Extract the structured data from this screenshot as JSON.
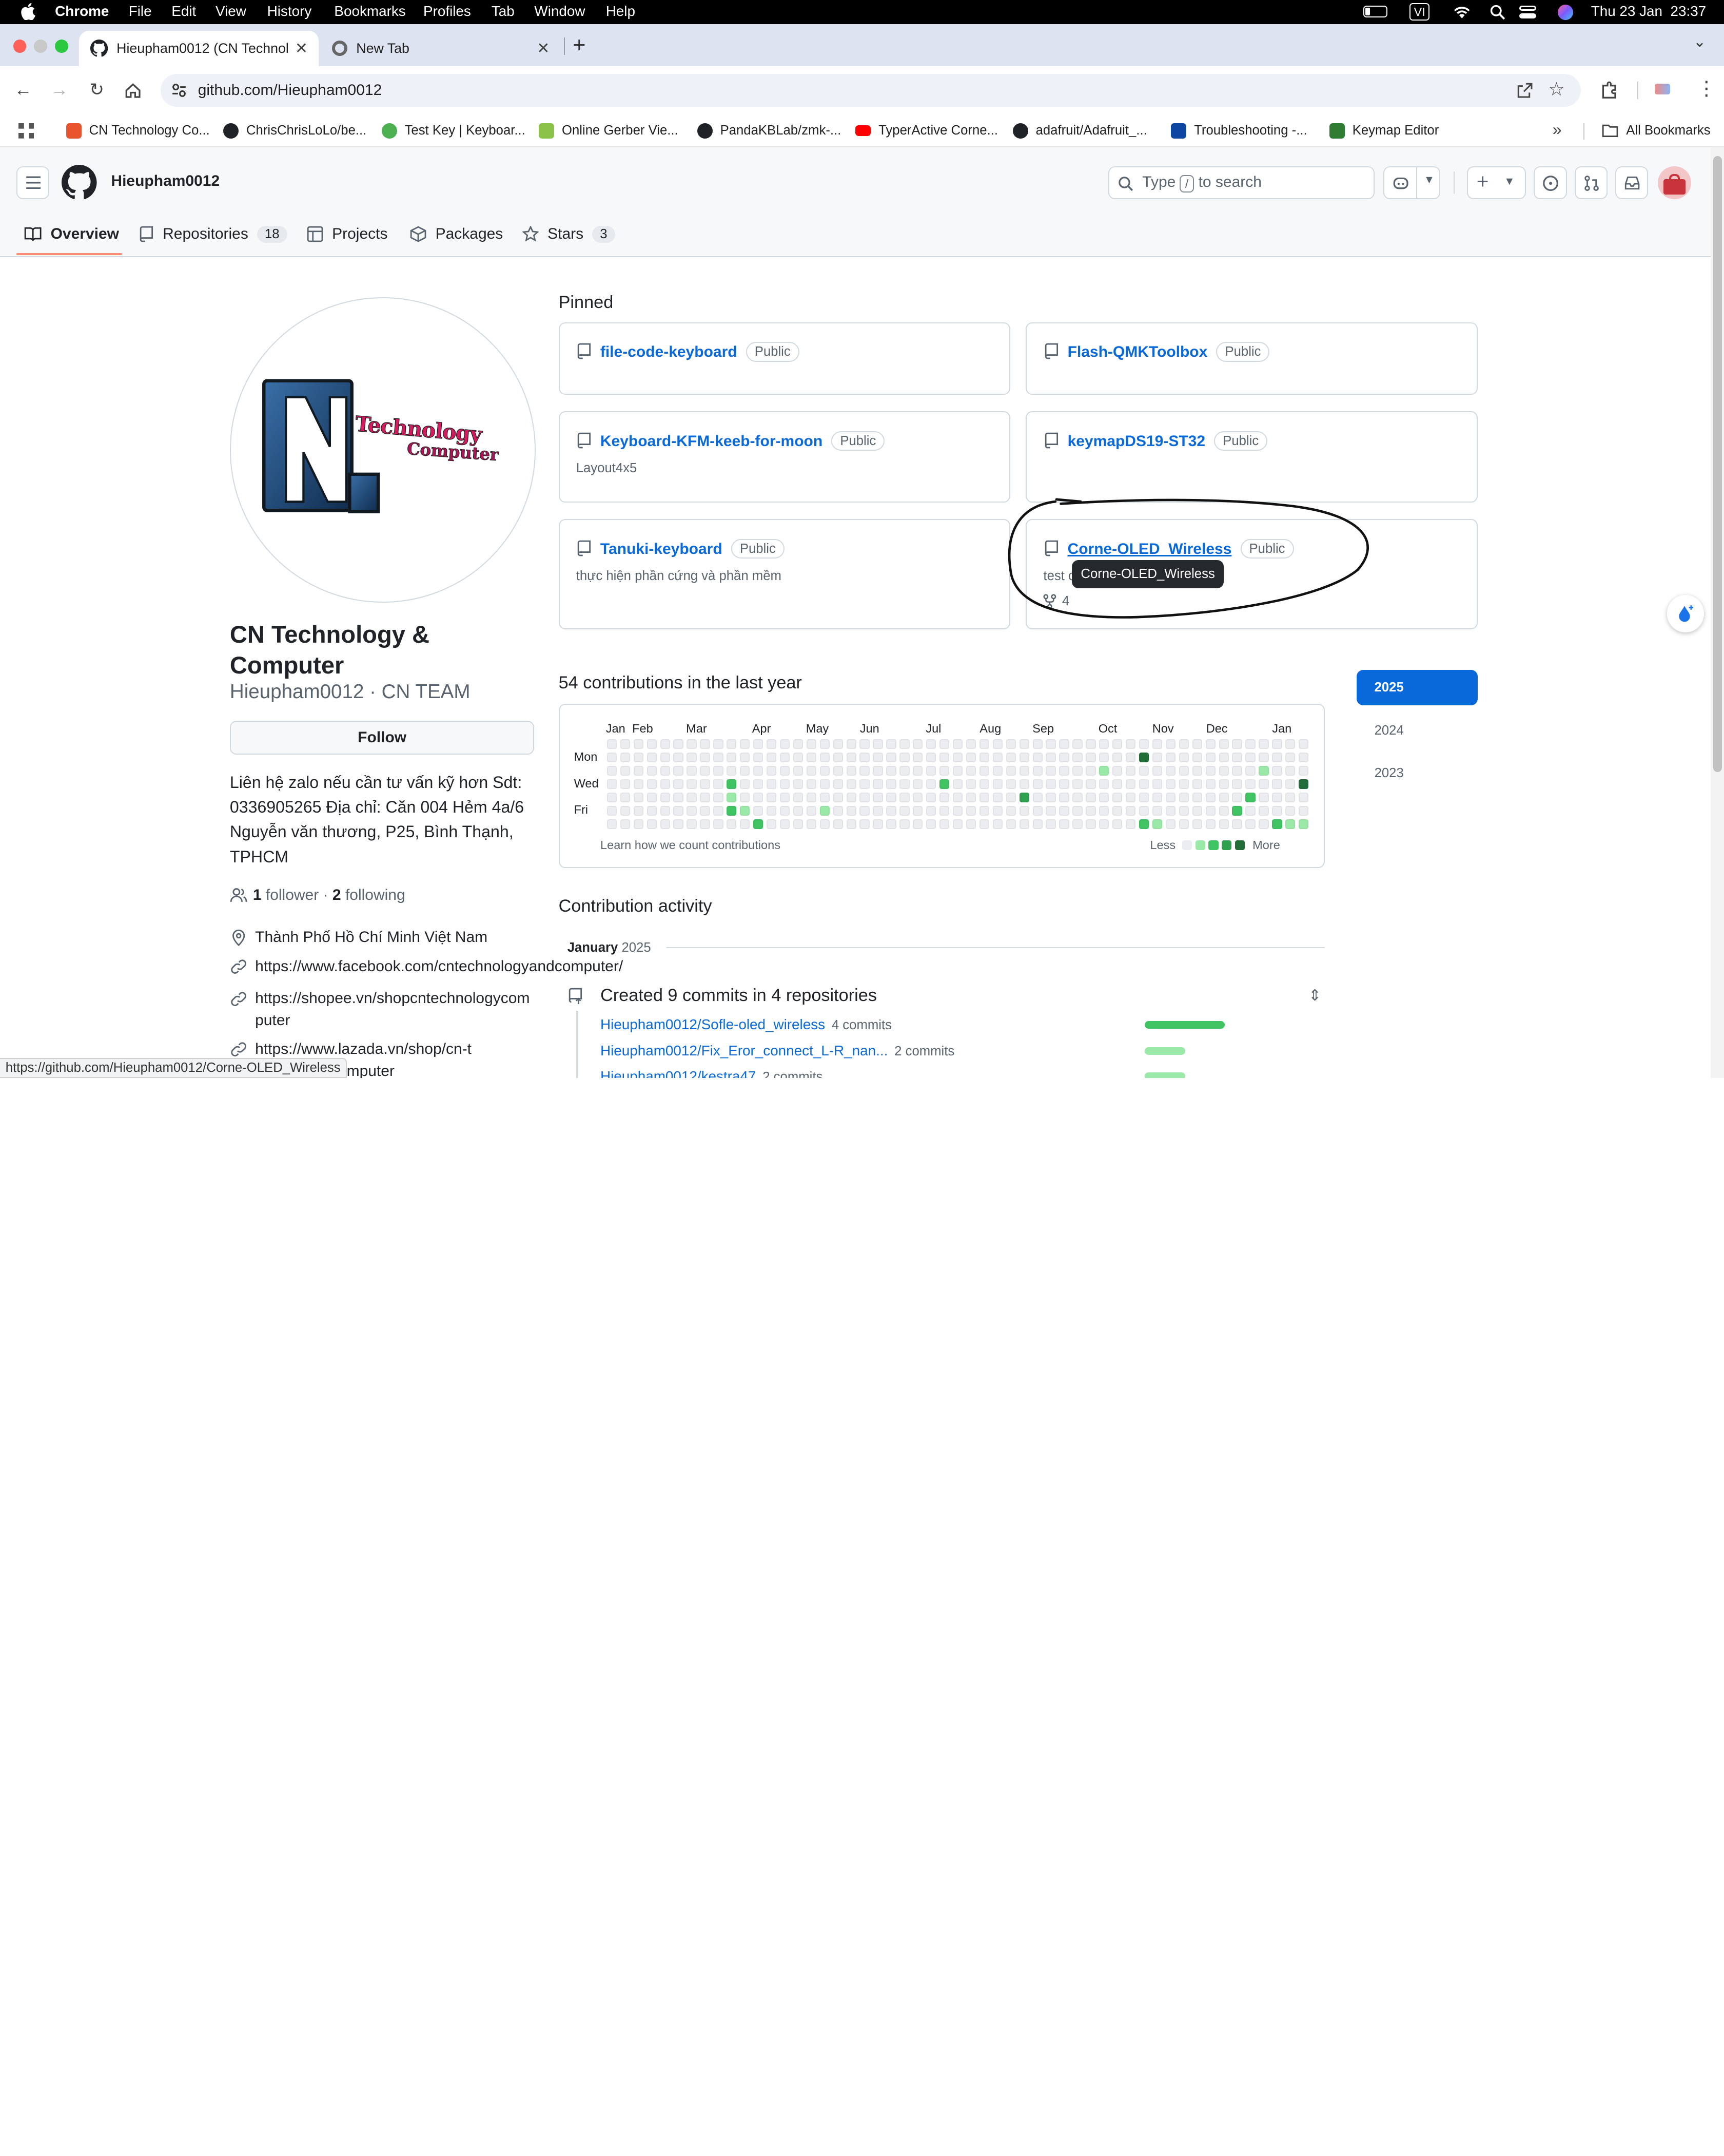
{
  "menubar": {
    "app": "Chrome",
    "items": [
      "File",
      "Edit",
      "View",
      "History",
      "Bookmarks",
      "Profiles",
      "Tab",
      "Window",
      "Help"
    ],
    "input_source": "VI",
    "clock": "Thu 23 Jan  23:37"
  },
  "tabs": [
    {
      "title": "Hieupham0012 (CN Technology & Computer)"
    },
    {
      "title": "New Tab"
    }
  ],
  "address": {
    "url": "github.com/Hieupham0012"
  },
  "bookmarks": [
    {
      "label": "CN Technology Co...",
      "color": "#e8542e"
    },
    {
      "label": "ChrisChrisLoLo/be...",
      "color": "#1f2328"
    },
    {
      "label": "Test Key | Keyboar...",
      "color": "#4caf50"
    },
    {
      "label": "Online Gerber Vie...",
      "color": "#8bc34a"
    },
    {
      "label": "PandaKBLab/zmk-...",
      "color": "#1f2328"
    },
    {
      "label": "TyperActive Corne...",
      "color": "#ff0000"
    },
    {
      "label": "adafruit/Adafruit_...",
      "color": "#1f2328"
    },
    {
      "label": "Troubleshooting -...",
      "color": "#0d47a1"
    },
    {
      "label": "Keymap Editor",
      "color": "#2e7d32"
    }
  ],
  "all_bookmarks": "All Bookmarks",
  "github": {
    "username": "Hieupham0012",
    "search_prefix": "Type",
    "search_key": "/",
    "search_suffix": "to search",
    "nav": [
      {
        "label": "Overview",
        "count": ""
      },
      {
        "label": "Repositories",
        "count": "18"
      },
      {
        "label": "Projects",
        "count": ""
      },
      {
        "label": "Packages",
        "count": ""
      },
      {
        "label": "Stars",
        "count": "3"
      }
    ]
  },
  "profile": {
    "logo_text_1": "Technology",
    "logo_text_2": "Computer",
    "name": "CN Technology & Computer",
    "login_line": "Hieupham0012 · CN TEAM",
    "follow_label": "Follow",
    "bio": "Liên hệ zalo nếu cần tư vấn kỹ hơn Sdt: 0336905265 Địa chỉ: Căn 004 Hẻm 4a/6 Nguyễn văn thương, P25, Bình Thạnh, TPHCM",
    "followers_count": "1",
    "followers_label": "follower",
    "following_count": "2",
    "following_label": "following",
    "location": "Thành Phố Hồ Chí Minh Việt Nam",
    "links": [
      "https://www.facebook.com/cntechnologyandcomputer/",
      "https://shopee.vn/shopcntechnologycomputer",
      "https://www.lazada.vn/shop/cn-technology-computer"
    ]
  },
  "pinned": {
    "title": "Pinned",
    "repos": [
      {
        "name": "file-code-keyboard",
        "visibility": "Public",
        "desc": ""
      },
      {
        "name": "Flash-QMKToolbox",
        "visibility": "Public",
        "desc": ""
      },
      {
        "name": "Keyboard-KFM-keeb-for-moon",
        "visibility": "Public",
        "desc": "Layout4x5"
      },
      {
        "name": "keymapDS19-ST32",
        "visibility": "Public",
        "desc": ""
      },
      {
        "name": "Tanuki-keyboard",
        "visibility": "Public",
        "desc": "thực hiện phần cứng và phần mềm"
      },
      {
        "name": "Corne-OLED_Wireless",
        "visibility": "Public",
        "desc": "test c",
        "forks": "4"
      }
    ],
    "tooltip": "Corne-OLED_Wireless"
  },
  "contributions": {
    "title": "54 contributions in the last year",
    "months": [
      "Jan",
      "Feb",
      "Mar",
      "Apr",
      "May",
      "Jun",
      "Jul",
      "Aug",
      "Sep",
      "Oct",
      "Nov",
      "Dec",
      "Jan"
    ],
    "days": [
      "Mon",
      "Wed",
      "Fri"
    ],
    "learn": "Learn how we count contributions",
    "less": "Less",
    "more": "More",
    "level_colors": [
      "#ebedf0",
      "#9be9a8",
      "#40c463",
      "#30a14e",
      "#216e39"
    ],
    "active_cells": [
      {
        "week": 9,
        "day": 3,
        "level": 2
      },
      {
        "week": 9,
        "day": 4,
        "level": 1
      },
      {
        "week": 9,
        "day": 5,
        "level": 2
      },
      {
        "week": 10,
        "day": 5,
        "level": 1
      },
      {
        "week": 11,
        "day": 6,
        "level": 2
      },
      {
        "week": 16,
        "day": 5,
        "level": 1
      },
      {
        "week": 25,
        "day": 3,
        "level": 2
      },
      {
        "week": 31,
        "day": 4,
        "level": 3
      },
      {
        "week": 37,
        "day": 2,
        "level": 1
      },
      {
        "week": 40,
        "day": 1,
        "level": 4
      },
      {
        "week": 40,
        "day": 6,
        "level": 2
      },
      {
        "week": 41,
        "day": 6,
        "level": 1
      },
      {
        "week": 47,
        "day": 5,
        "level": 2
      },
      {
        "week": 48,
        "day": 4,
        "level": 2
      },
      {
        "week": 49,
        "day": 2,
        "level": 1
      },
      {
        "week": 50,
        "day": 6,
        "level": 2
      },
      {
        "week": 51,
        "day": 6,
        "level": 1
      },
      {
        "week": 52,
        "day": 6,
        "level": 1
      },
      {
        "week": 52,
        "day": 3,
        "level": 4
      }
    ],
    "years": [
      "2025",
      "2024",
      "2023"
    ],
    "selected_year": "2025"
  },
  "activity": {
    "title": "Contribution activity",
    "month": "January",
    "year": "2025",
    "summary": "Created 9 commits in 4 repositories",
    "rows": [
      {
        "repo": "Hieupham0012/Sofle-oled_wireless",
        "commits": "4 commits",
        "share": 0.44
      },
      {
        "repo": "Hieupham0012/Fix_Eror_connect_L-R_nan...",
        "commits": "2 commits",
        "share": 0.22
      },
      {
        "repo": "Hieupham0012/kestra47",
        "commits": "2 commits",
        "share": 0.22
      }
    ]
  },
  "status_url": "https://github.com/Hieupham0012/Corne-OLED_Wireless"
}
